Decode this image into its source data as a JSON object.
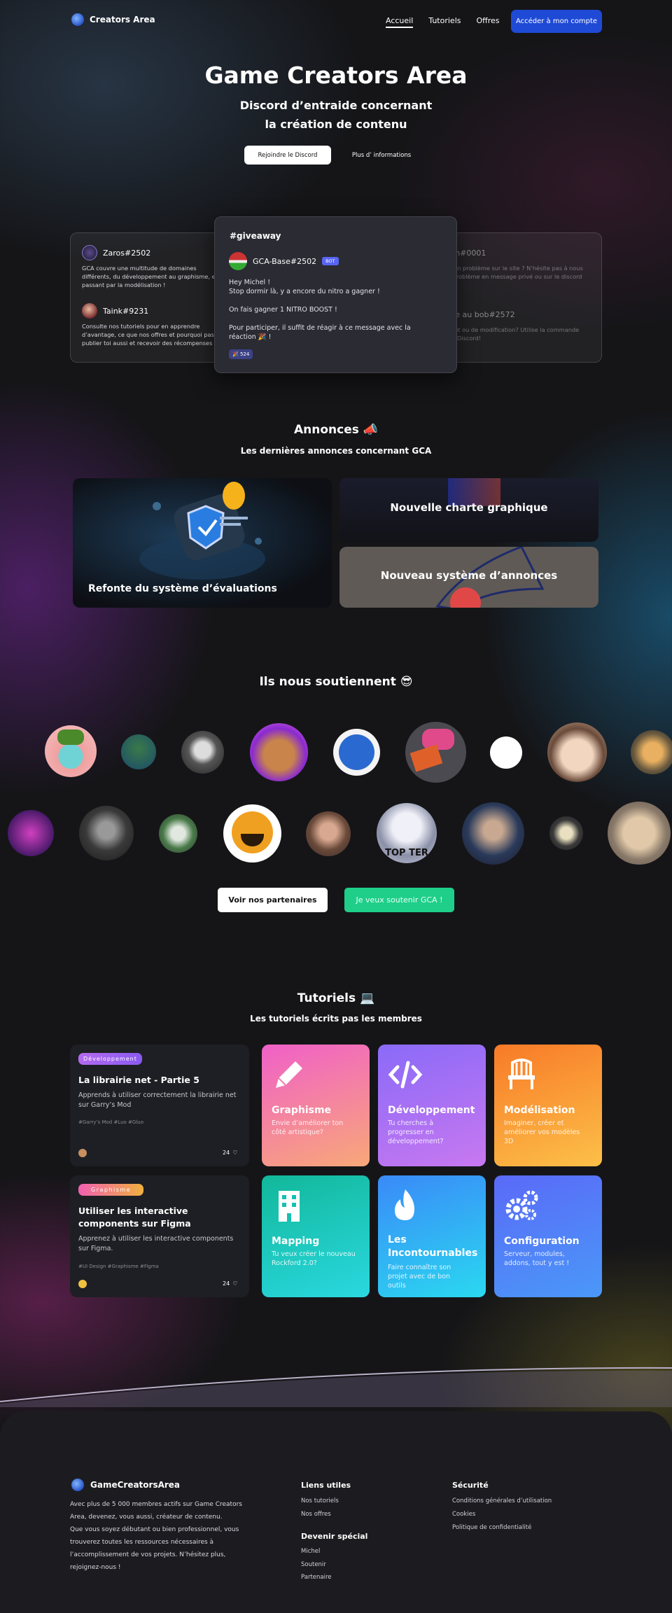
{
  "header": {
    "logo_text": "Creators Area",
    "nav": [
      "Accueil",
      "Tutoriels",
      "Offres"
    ],
    "cta": "Accéder à mon compte"
  },
  "hero": {
    "title": "Game Creators Area",
    "subtitle_line1": "Discord d’entraide concernant",
    "subtitle_line2": "la création de contenu",
    "btn_join": "Rejoindre le Discord",
    "btn_info": "Plus d’ informations"
  },
  "discord": {
    "left": [
      {
        "name": "Zaros#2502",
        "text": "GCA couvre une multitude de domaines différents, du développement au graphisme, en passant par la modélisation !"
      },
      {
        "name": "Taink#9231",
        "text": "Consulte nos tutoriels pour en apprendre d’avantage, ce que nos offres et pourquoi pas publier toi aussi et recevoir des récompenses !"
      }
    ],
    "right": [
      {
        "name": "Lemon#0001",
        "text": "Tu rencontres un problème sur le site ? N’hésite pas à nous remonter ton problème en message privé ou sur le discord de GCA !"
      },
      {
        "name": "Bisque au bob#2572",
        "text": "Une idée d’ajout ou de modification? Utilise la commande /suggest sur le Discord!"
      }
    ],
    "center": {
      "channel": "#giveaway",
      "name": "GCA-Base#2502",
      "badge": "BOT",
      "line1": "Hey Michel !",
      "line2": "Stop  dormir là, y a encore du nitro a gagner !",
      "line3": "On fais gagner 1 NITRO BOOST !",
      "line4": "Pour participer, il suffit de réagir à ce message avec la réaction 🎉 !",
      "reaction": "🎉 524"
    }
  },
  "announcements": {
    "title": "Annonces 📣",
    "subtitle": "Les dernières annonces concernant GCA",
    "items": [
      "Refonte du système d’évaluations",
      "Nouvelle charte graphique",
      "Nouveau système d’annonces"
    ]
  },
  "supporters": {
    "title": "Ils nous soutiennent 😎",
    "btn_partners": "Voir nos partenaires",
    "btn_support": "Je veux soutenir GCA !",
    "cookie_caption": "TOP TER"
  },
  "tutorials": {
    "title": "Tutoriels 💻",
    "subtitle": "Les tutoriels écrits pas les membres",
    "posts": [
      {
        "tag": "Développement",
        "title": "La librairie net - Partie 5",
        "desc": "Apprends à utiliser correctement la librairie net sur Garry’s Mod",
        "tags": "#Garry’s Mod #Luo #Gluo",
        "likes": "24"
      },
      {
        "tag": "Graphisme",
        "title": "Utiliser les interactive components sur Figma",
        "desc": "Apprenez à utiliser les interactive components sur Figma.",
        "tags": "#UI Design #Graphisme #Figma",
        "likes": "24"
      }
    ],
    "categories": [
      {
        "title": "Graphisme",
        "desc": "Envie d’améliorer ton côté artistique?",
        "icon": "pencil-icon"
      },
      {
        "title": "Développement",
        "desc": "Tu cherches  à progresser en développement?",
        "icon": "code-icon"
      },
      {
        "title": "Modélisation",
        "desc": "Imaginer, créer et améliorer vos modèles 3D",
        "icon": "chair-icon"
      },
      {
        "title": "Mapping",
        "desc": "Tu veux créer le nouveau Rockford 2.0?",
        "icon": "building-icon"
      },
      {
        "title": "Les Incontournables",
        "desc": "Faire connaître son projet avec de bon outils",
        "icon": "fire-icon"
      },
      {
        "title": "Configuration",
        "desc": "Serveur, modules, addons, tout y est !",
        "icon": "gears-icon"
      }
    ]
  },
  "footer": {
    "brand": "GameCreatorsArea",
    "about": [
      "Avec plus de 5 000 membres actifs sur Game Creators",
      "Area, devenez, vous aussi, créateur de contenu.",
      "Que vous soyez débutant ou bien professionnel, vous",
      "trouverez toutes les ressources nécessaires à",
      "l’accomplissement de vos projets. N’hésitez plus,",
      "rejoignez-nous !"
    ],
    "links_title": "Liens utiles",
    "links": [
      "Nos tutoriels",
      "Nos offres"
    ],
    "special_title": "Devenir spécial",
    "special": [
      "Michel",
      "Soutenir",
      "Partenaire"
    ],
    "security_title": "Sécurité",
    "security": [
      "Conditions générales d’utilisation",
      "Cookies",
      "Politique de confidentialité"
    ]
  },
  "colors": {
    "accent": "#1f4ad6",
    "support": "#1fcf89"
  }
}
